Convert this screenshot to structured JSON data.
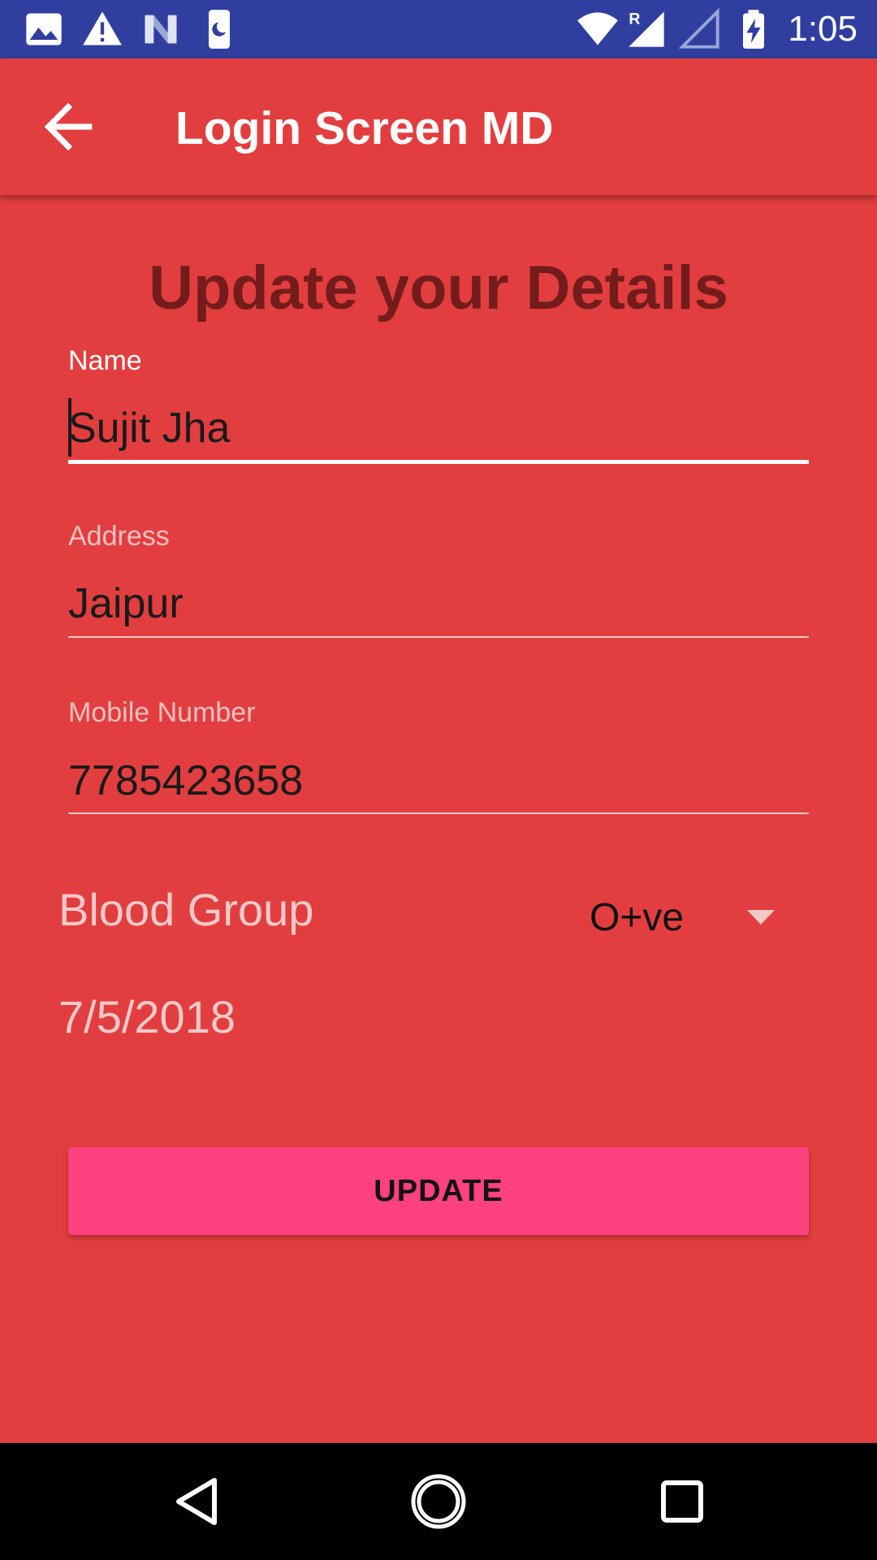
{
  "status_bar": {
    "time": "1:05",
    "background": "#303f9f",
    "icons": [
      "image-icon",
      "warning-icon",
      "n-logo-icon",
      "phone-moon-icon",
      "wifi-icon",
      "signal-roaming-icon",
      "signal-empty-icon",
      "battery-charging-icon"
    ]
  },
  "app_bar": {
    "title": "Login Screen MD",
    "back_icon": "arrow-back-icon",
    "color": "#e33e3f"
  },
  "form": {
    "heading": "Update your Details",
    "name": {
      "label": "Name",
      "value": "Sujit Jha"
    },
    "address": {
      "label": "Address",
      "value": "Jaipur"
    },
    "mobile": {
      "label": "Mobile Number",
      "value": "7785423658"
    },
    "blood_group": {
      "label": "Blood Group",
      "selected": "O+ve"
    },
    "date": "7/5/2018",
    "update_button": "UPDATE",
    "accent": "#ff4081"
  },
  "nav_bar": {
    "icons": [
      "back-triangle-icon",
      "home-circle-icon",
      "recents-square-icon"
    ]
  }
}
